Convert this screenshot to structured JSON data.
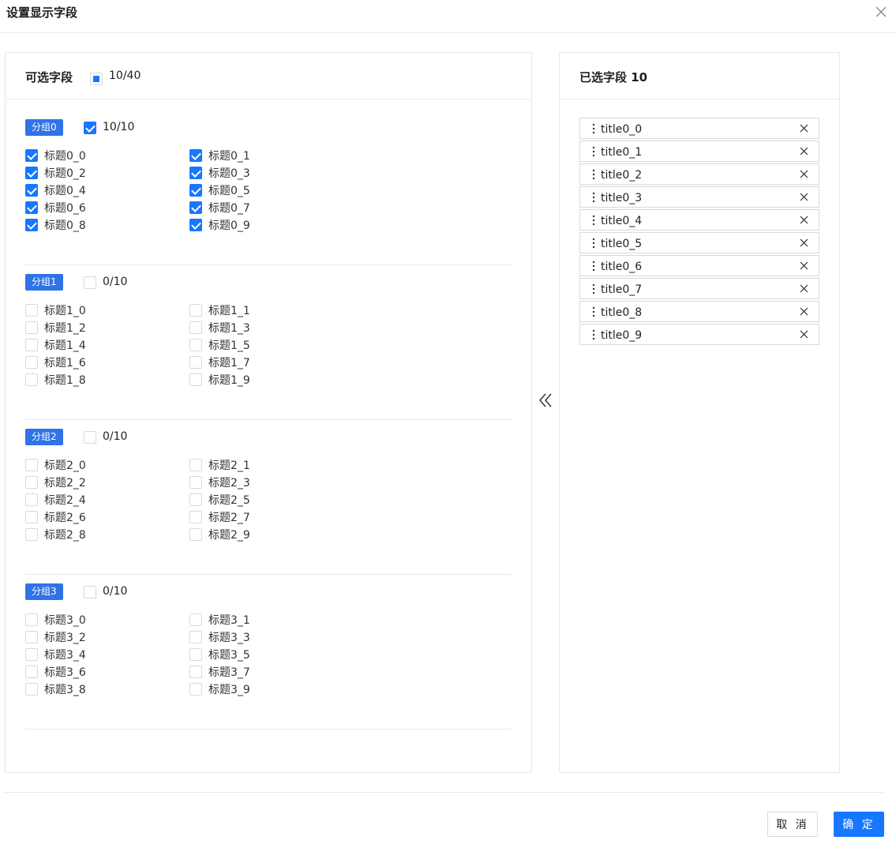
{
  "dialog": {
    "title": "设置显示字段",
    "cancel_label": "取 消",
    "ok_label": "确 定"
  },
  "available": {
    "title": "可选字段",
    "count": "10/40",
    "groups": [
      {
        "name": "分组0",
        "count": "10/10",
        "all_checked": true,
        "items": [
          {
            "label": "标题0_0",
            "checked": true
          },
          {
            "label": "标题0_1",
            "checked": true
          },
          {
            "label": "标题0_2",
            "checked": true
          },
          {
            "label": "标题0_3",
            "checked": true
          },
          {
            "label": "标题0_4",
            "checked": true
          },
          {
            "label": "标题0_5",
            "checked": true
          },
          {
            "label": "标题0_6",
            "checked": true
          },
          {
            "label": "标题0_7",
            "checked": true
          },
          {
            "label": "标题0_8",
            "checked": true
          },
          {
            "label": "标题0_9",
            "checked": true
          }
        ]
      },
      {
        "name": "分组1",
        "count": "0/10",
        "all_checked": false,
        "items": [
          {
            "label": "标题1_0",
            "checked": false
          },
          {
            "label": "标题1_1",
            "checked": false
          },
          {
            "label": "标题1_2",
            "checked": false
          },
          {
            "label": "标题1_3",
            "checked": false
          },
          {
            "label": "标题1_4",
            "checked": false
          },
          {
            "label": "标题1_5",
            "checked": false
          },
          {
            "label": "标题1_6",
            "checked": false
          },
          {
            "label": "标题1_7",
            "checked": false
          },
          {
            "label": "标题1_8",
            "checked": false
          },
          {
            "label": "标题1_9",
            "checked": false
          }
        ]
      },
      {
        "name": "分组2",
        "count": "0/10",
        "all_checked": false,
        "items": [
          {
            "label": "标题2_0",
            "checked": false
          },
          {
            "label": "标题2_1",
            "checked": false
          },
          {
            "label": "标题2_2",
            "checked": false
          },
          {
            "label": "标题2_3",
            "checked": false
          },
          {
            "label": "标题2_4",
            "checked": false
          },
          {
            "label": "标题2_5",
            "checked": false
          },
          {
            "label": "标题2_6",
            "checked": false
          },
          {
            "label": "标题2_7",
            "checked": false
          },
          {
            "label": "标题2_8",
            "checked": false
          },
          {
            "label": "标题2_9",
            "checked": false
          }
        ]
      },
      {
        "name": "分组3",
        "count": "0/10",
        "all_checked": false,
        "items": [
          {
            "label": "标题3_0",
            "checked": false
          },
          {
            "label": "标题3_1",
            "checked": false
          },
          {
            "label": "标题3_2",
            "checked": false
          },
          {
            "label": "标题3_3",
            "checked": false
          },
          {
            "label": "标题3_4",
            "checked": false
          },
          {
            "label": "标题3_5",
            "checked": false
          },
          {
            "label": "标题3_6",
            "checked": false
          },
          {
            "label": "标题3_7",
            "checked": false
          },
          {
            "label": "标题3_8",
            "checked": false
          },
          {
            "label": "标题3_9",
            "checked": false
          }
        ]
      }
    ]
  },
  "selected": {
    "title": "已选字段 10",
    "items": [
      "title0_0",
      "title0_1",
      "title0_2",
      "title0_3",
      "title0_4",
      "title0_5",
      "title0_6",
      "title0_7",
      "title0_8",
      "title0_9"
    ]
  },
  "colors": {
    "accent": "#1677ff",
    "badge": "#2f73e6",
    "border": "#e6e6e6"
  }
}
